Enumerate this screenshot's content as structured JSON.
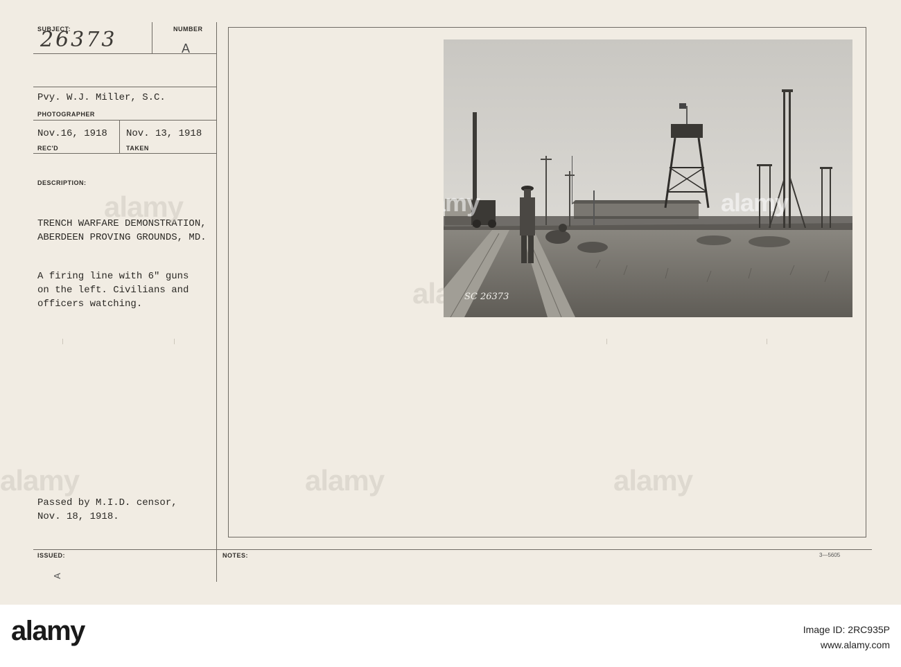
{
  "card": {
    "subject_label": "SUBJECT:",
    "subject_number": "26373",
    "number_label": "NUMBER",
    "number_value": "A",
    "photographer": "Pvy. W.J. Miller, S.C.",
    "photographer_label": "PHOTOGRAPHER",
    "received_date": "Nov.16, 1918",
    "received_label": "REC'D",
    "taken_date": "Nov. 13, 1918",
    "taken_label": "TAKEN",
    "description_label": "DESCRIPTION:",
    "title_line1": "TRENCH WARFARE DEMONSTRATION,",
    "title_line2": "ABERDEEN PROVING GROUNDS, MD.",
    "desc_line1": "A firing line with 6\" guns",
    "desc_line2": "on the left. Civilians and",
    "desc_line3": "officers watching.",
    "censor_line1": "Passed by M.I.D. censor,",
    "censor_line2": "Nov. 18, 1918.",
    "issued_label": "ISSUED:",
    "issued_mark": "A",
    "notes_label": "NOTES:",
    "form_number": "3—5605",
    "photo_inscription": "SC 26373",
    "watermark": "alamy"
  },
  "footer": {
    "logo": "alamy",
    "image_id_label": "Image ID: 2RC935P",
    "site": "www.alamy.com"
  }
}
